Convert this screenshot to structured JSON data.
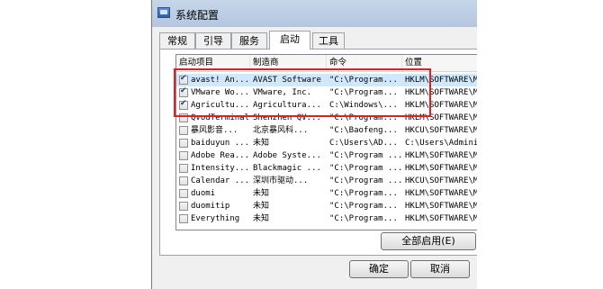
{
  "window": {
    "title": "系统配置"
  },
  "tabs": [
    {
      "label": "常规",
      "active": false
    },
    {
      "label": "引导",
      "active": false
    },
    {
      "label": "服务",
      "active": false
    },
    {
      "label": "启动",
      "active": true
    },
    {
      "label": "工具",
      "active": false
    }
  ],
  "table": {
    "headers": [
      "启动项目",
      "制造商",
      "命令",
      "位置"
    ],
    "rows": [
      {
        "checked": true,
        "item": "avast! An...",
        "maker": "AVAST Software",
        "command": "\"C:\\Program...",
        "location": "HKLM\\SOFTWARE\\M..."
      },
      {
        "checked": true,
        "item": "VMware Wo...",
        "maker": "VMware, Inc.",
        "command": "\"C:\\Program...",
        "location": "HKLM\\SOFTWARE\\M..."
      },
      {
        "checked": true,
        "item": "Agricultu...",
        "maker": "Agricultura...",
        "command": "C:\\Windows\\...",
        "location": "HKLM\\SOFTWARE\\M..."
      },
      {
        "checked": false,
        "item": "QvodTerminal",
        "maker": "Shenzhen QV...",
        "command": "\"C:\\Program...",
        "location": "HKLM\\SOFTWARE\\M..."
      },
      {
        "checked": false,
        "item": "暴风影音...",
        "maker": "北京暴风科...",
        "command": "\"C:\\Baofeng...",
        "location": "HKCU\\SOFTWARE\\M..."
      },
      {
        "checked": false,
        "item": "baiduyun ...",
        "maker": "未知",
        "command": "C:\\Users\\AD...",
        "location": "C:\\Users\\Admini..."
      },
      {
        "checked": false,
        "item": "Adobe Rea...",
        "maker": "Adobe Syste...",
        "command": "\"C:\\Program ...",
        "location": "HKLM\\SOFTWARE\\M..."
      },
      {
        "checked": false,
        "item": "Intensity...",
        "maker": "Blackmagic ...",
        "command": "\"C:\\Program ...",
        "location": "HKLM\\SOFTWARE\\M..."
      },
      {
        "checked": false,
        "item": "Calendar ...",
        "maker": "深圳市驱动...",
        "command": "\"C:\\Program ...",
        "location": "HKCU\\SOFTWARE\\M..."
      },
      {
        "checked": false,
        "item": "duomi",
        "maker": "未知",
        "command": "\"C:\\Program...",
        "location": "HKLM\\SOFTWARE\\M..."
      },
      {
        "checked": false,
        "item": "duomitip",
        "maker": "未知",
        "command": "\"C:\\Program...",
        "location": "HKLM\\SOFTWARE\\M..."
      },
      {
        "checked": false,
        "item": "Everything",
        "maker": "未知",
        "command": "\"C:\\Program...",
        "location": "HKLM\\SOFTWARE\\M..."
      }
    ]
  },
  "buttons": {
    "enable_all": "全部启用(E)",
    "ok": "确定",
    "cancel": "取消"
  },
  "colors": {
    "highlight_box": "#e0201e",
    "selected_row": "#cfe8fc"
  }
}
